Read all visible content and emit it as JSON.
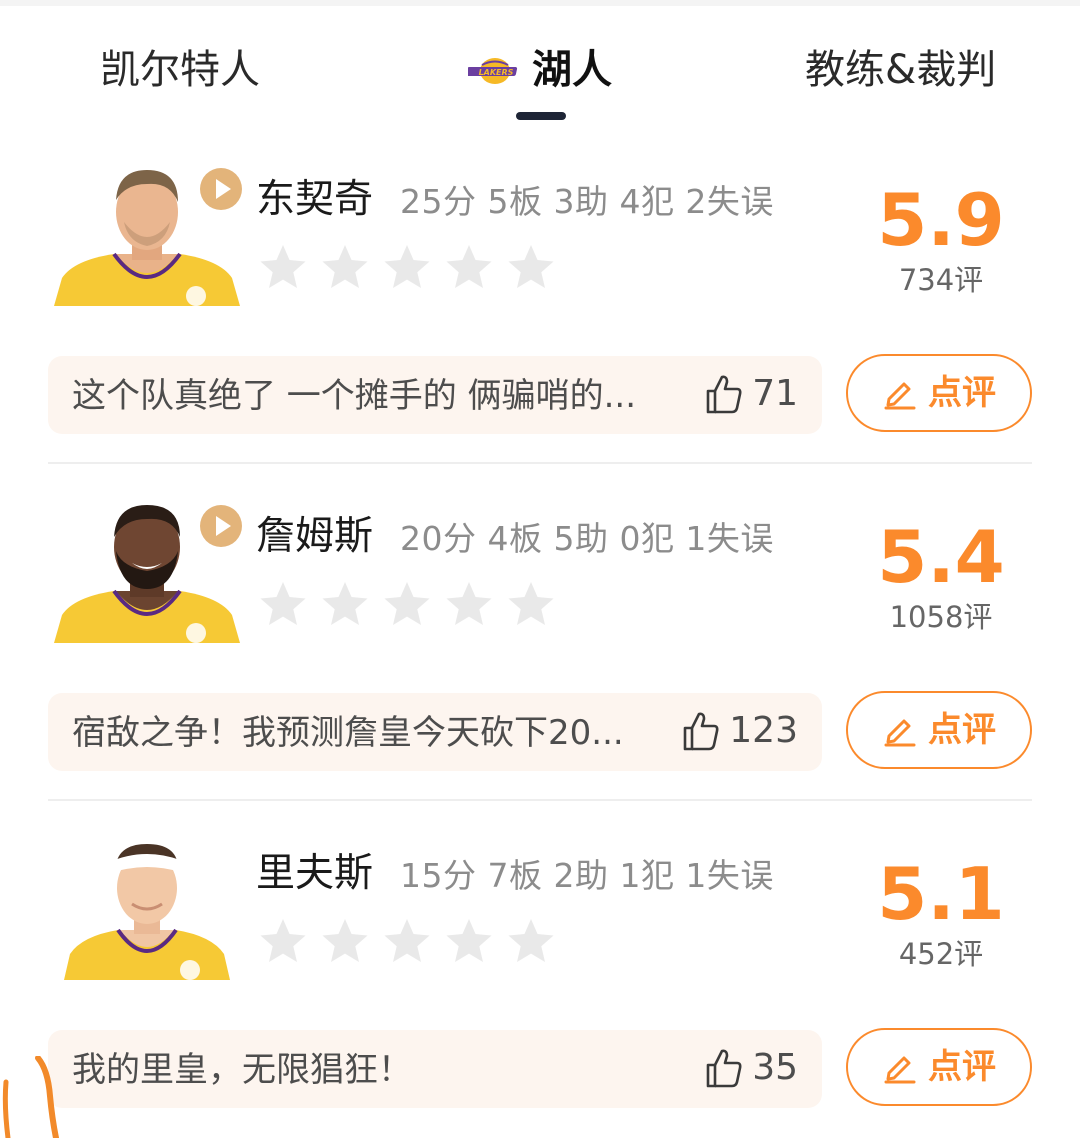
{
  "tabs": [
    {
      "label": "凯尔特人",
      "active": false
    },
    {
      "label": "湖人",
      "active": true,
      "logo_text": "LAKERS"
    },
    {
      "label": "教练&裁判",
      "active": false
    }
  ],
  "players": [
    {
      "name": "东契奇",
      "stats": "25分 5板 3助 4犯 2失误",
      "has_video": true,
      "score": "5.9",
      "reviews": "734评",
      "stars_filled": 0,
      "comment": "这个队真绝了  一个摊手的 俩骗哨的...",
      "likes": "71",
      "rate_label": "点评"
    },
    {
      "name": "詹姆斯",
      "stats": "20分 4板 5助 0犯 1失误",
      "has_video": true,
      "score": "5.4",
      "reviews": "1058评",
      "stars_filled": 0,
      "comment": "宿敌之争！我预测詹皇今天砍下20...",
      "likes": "123",
      "rate_label": "点评"
    },
    {
      "name": "里夫斯",
      "stats": "15分 7板 2助 1犯 1失误",
      "has_video": false,
      "score": "5.1",
      "reviews": "452评",
      "stars_filled": 0,
      "comment": "我的里皇，无限猖狂！",
      "likes": "35",
      "rate_label": "点评"
    }
  ],
  "colors": {
    "accent": "#fb8a2c",
    "comment_bg": "#fdf5ef",
    "star_empty": "#e9e9e9",
    "play_btn": "#e3b47a",
    "jersey": "#f6c935"
  },
  "icons": {
    "play": "play-icon",
    "star": "star-icon",
    "like": "thumbs-up-icon",
    "rate": "pen-icon"
  }
}
